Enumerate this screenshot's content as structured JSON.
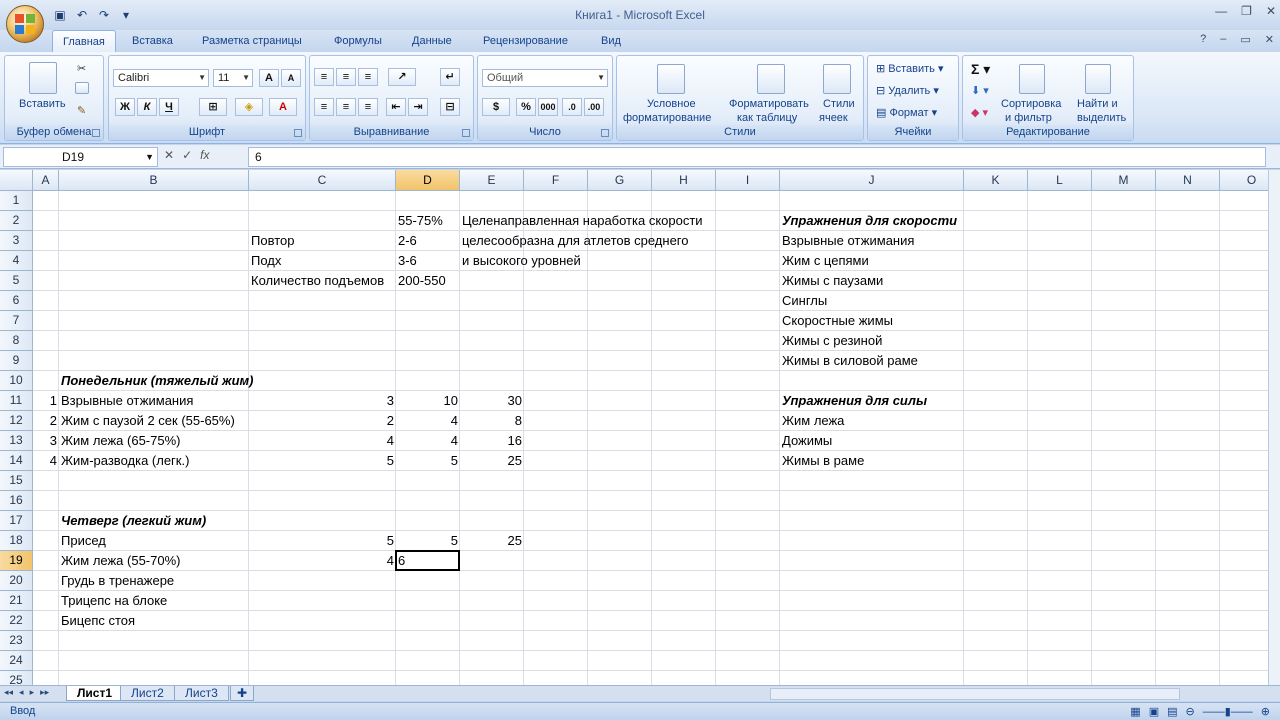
{
  "window": {
    "title": "Книга1 - Microsoft Excel"
  },
  "ribbon_tabs": [
    "Главная",
    "Вставка",
    "Разметка страницы",
    "Формулы",
    "Данные",
    "Рецензирование",
    "Вид"
  ],
  "groups": {
    "clipboard": {
      "label": "Буфер обмена",
      "paste": "Вставить"
    },
    "font": {
      "label": "Шрифт",
      "font_name": "Calibri",
      "font_size": "11",
      "bold": "Ж",
      "italic": "К",
      "underline": "Ч"
    },
    "alignment": {
      "label": "Выравнивание"
    },
    "number": {
      "label": "Число",
      "format": "Общий"
    },
    "styles": {
      "label": "Стили",
      "conditional_1": "Условное",
      "conditional_2": "форматирование",
      "table_1": "Форматировать",
      "table_2": "как таблицу",
      "cell_styles_1": "Стили",
      "cell_styles_2": "ячеек"
    },
    "cells": {
      "label": "Ячейки",
      "insert": "Вставить",
      "delete": "Удалить",
      "format": "Формат"
    },
    "editing": {
      "label": "Редактирование",
      "sort_1": "Сортировка",
      "sort_2": "и фильтр",
      "find_1": "Найти и",
      "find_2": "выделить"
    }
  },
  "formula_bar": {
    "name_box": "D19",
    "value": "6"
  },
  "columns": [
    "A",
    "B",
    "C",
    "D",
    "E",
    "F",
    "G",
    "H",
    "I",
    "J",
    "K",
    "L",
    "M",
    "N",
    "O"
  ],
  "rows": [
    "1",
    "2",
    "3",
    "4",
    "5",
    "6",
    "7",
    "8",
    "9",
    "10",
    "11",
    "12",
    "13",
    "14",
    "15",
    "16",
    "17",
    "18",
    "19",
    "20",
    "21",
    "22",
    "23",
    "24",
    "25"
  ],
  "cells": {
    "D2": "55-75%",
    "E2": "Целенаправленная наработка скорости",
    "J2": "Упражнения для скорости",
    "C3": "Повтор",
    "D3": "2-6",
    "E3": "целесообразна для атлетов среднего",
    "J3": "Взрывные отжимания",
    "C4": "Подх",
    "D4": "3-6",
    "E4": "и высокого уровней",
    "J4": "Жим с цепями",
    "C5": "Количество подъемов",
    "D5": "200-550",
    "J5": "Жимы с паузами",
    "J6": "Синглы",
    "J7": "Скоростные жимы",
    "J8": "Жимы с резиной",
    "J9": "Жимы в силовой раме",
    "B10": "Понедельник (тяжелый жим)",
    "A11": "1",
    "B11": "Взрывные отжимания",
    "C11": "3",
    "D11": "10",
    "E11": "30",
    "J11": "Упражнения для силы",
    "A12": "2",
    "B12": "Жим с паузой 2 сек (55-65%)",
    "C12": "2",
    "D12": "4",
    "E12": "8",
    "J12": "Жим лежа",
    "A13": "3",
    "B13": "Жим лежа (65-75%)",
    "C13": "4",
    "D13": "4",
    "E13": "16",
    "J13": "Дожимы",
    "A14": "4",
    "B14": "Жим-разводка (легк.)",
    "C14": "5",
    "D14": "5",
    "E14": "25",
    "J14": "Жимы в раме",
    "B17": "Четверг (легкий жим)",
    "B18": "Присед",
    "C18": "5",
    "D18": "5",
    "E18": "25",
    "B19": "Жим лежа (55-70%)",
    "C19": "4",
    "D19": "6",
    "B20": "Грудь в тренажере",
    "B21": "Трицепс на блоке",
    "B22": "Бицепс стоя"
  },
  "sheets": [
    "Лист1",
    "Лист2",
    "Лист3"
  ],
  "status": {
    "mode": "Ввод"
  }
}
